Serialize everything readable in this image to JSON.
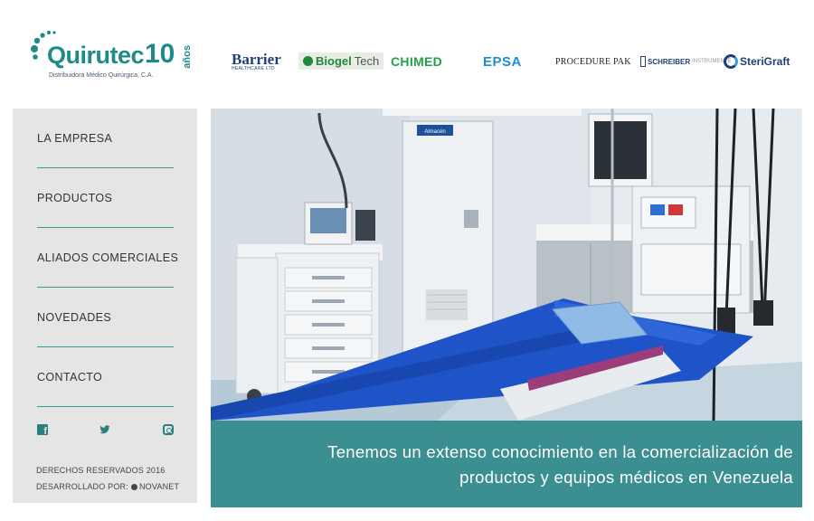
{
  "logo": {
    "name": "Quirutec",
    "years": "10",
    "years_word": "años",
    "tagline": "Distribuidora Médico Quirúrgica, C.A."
  },
  "brands": {
    "barrier": "Barrier",
    "barrier_sub": "HEALTHCARE LTD",
    "biogel_main": "Biogel",
    "biogel_tech": "Tech",
    "chimed": "CHIMED",
    "epsa": "EPSA",
    "procedure_pak": "PROCEDURE PAK",
    "schreiber": "SCHREIBER",
    "schreiber_sub": "INSTRUMENTE",
    "sterigraft": "SteriGraft"
  },
  "nav": {
    "items": [
      {
        "label": "LA EMPRESA"
      },
      {
        "label": "PRODUCTOS"
      },
      {
        "label": "ALIADOS COMERCIALES"
      },
      {
        "label": "NOVEDADES"
      },
      {
        "label": "CONTACTO"
      }
    ]
  },
  "social": {
    "icons": [
      "facebook-icon",
      "twitter-icon",
      "instagram-icon"
    ]
  },
  "footer": {
    "copyright": "DERECHOS RESERVADOS 2016",
    "developer_label": "DESARROLLADO POR:",
    "developer_name": "NOVANET"
  },
  "hero": {
    "door_sign": "Almacén",
    "caption_line1": "Tenemos un extenso conocimiento en la comercialización de",
    "caption_line2": "productos y equipos médicos en Venezuela"
  },
  "colors": {
    "accent": "#3b8f90",
    "sidebar_bg": "#e5e5e5",
    "brand_teal": "#1f8a8a"
  }
}
